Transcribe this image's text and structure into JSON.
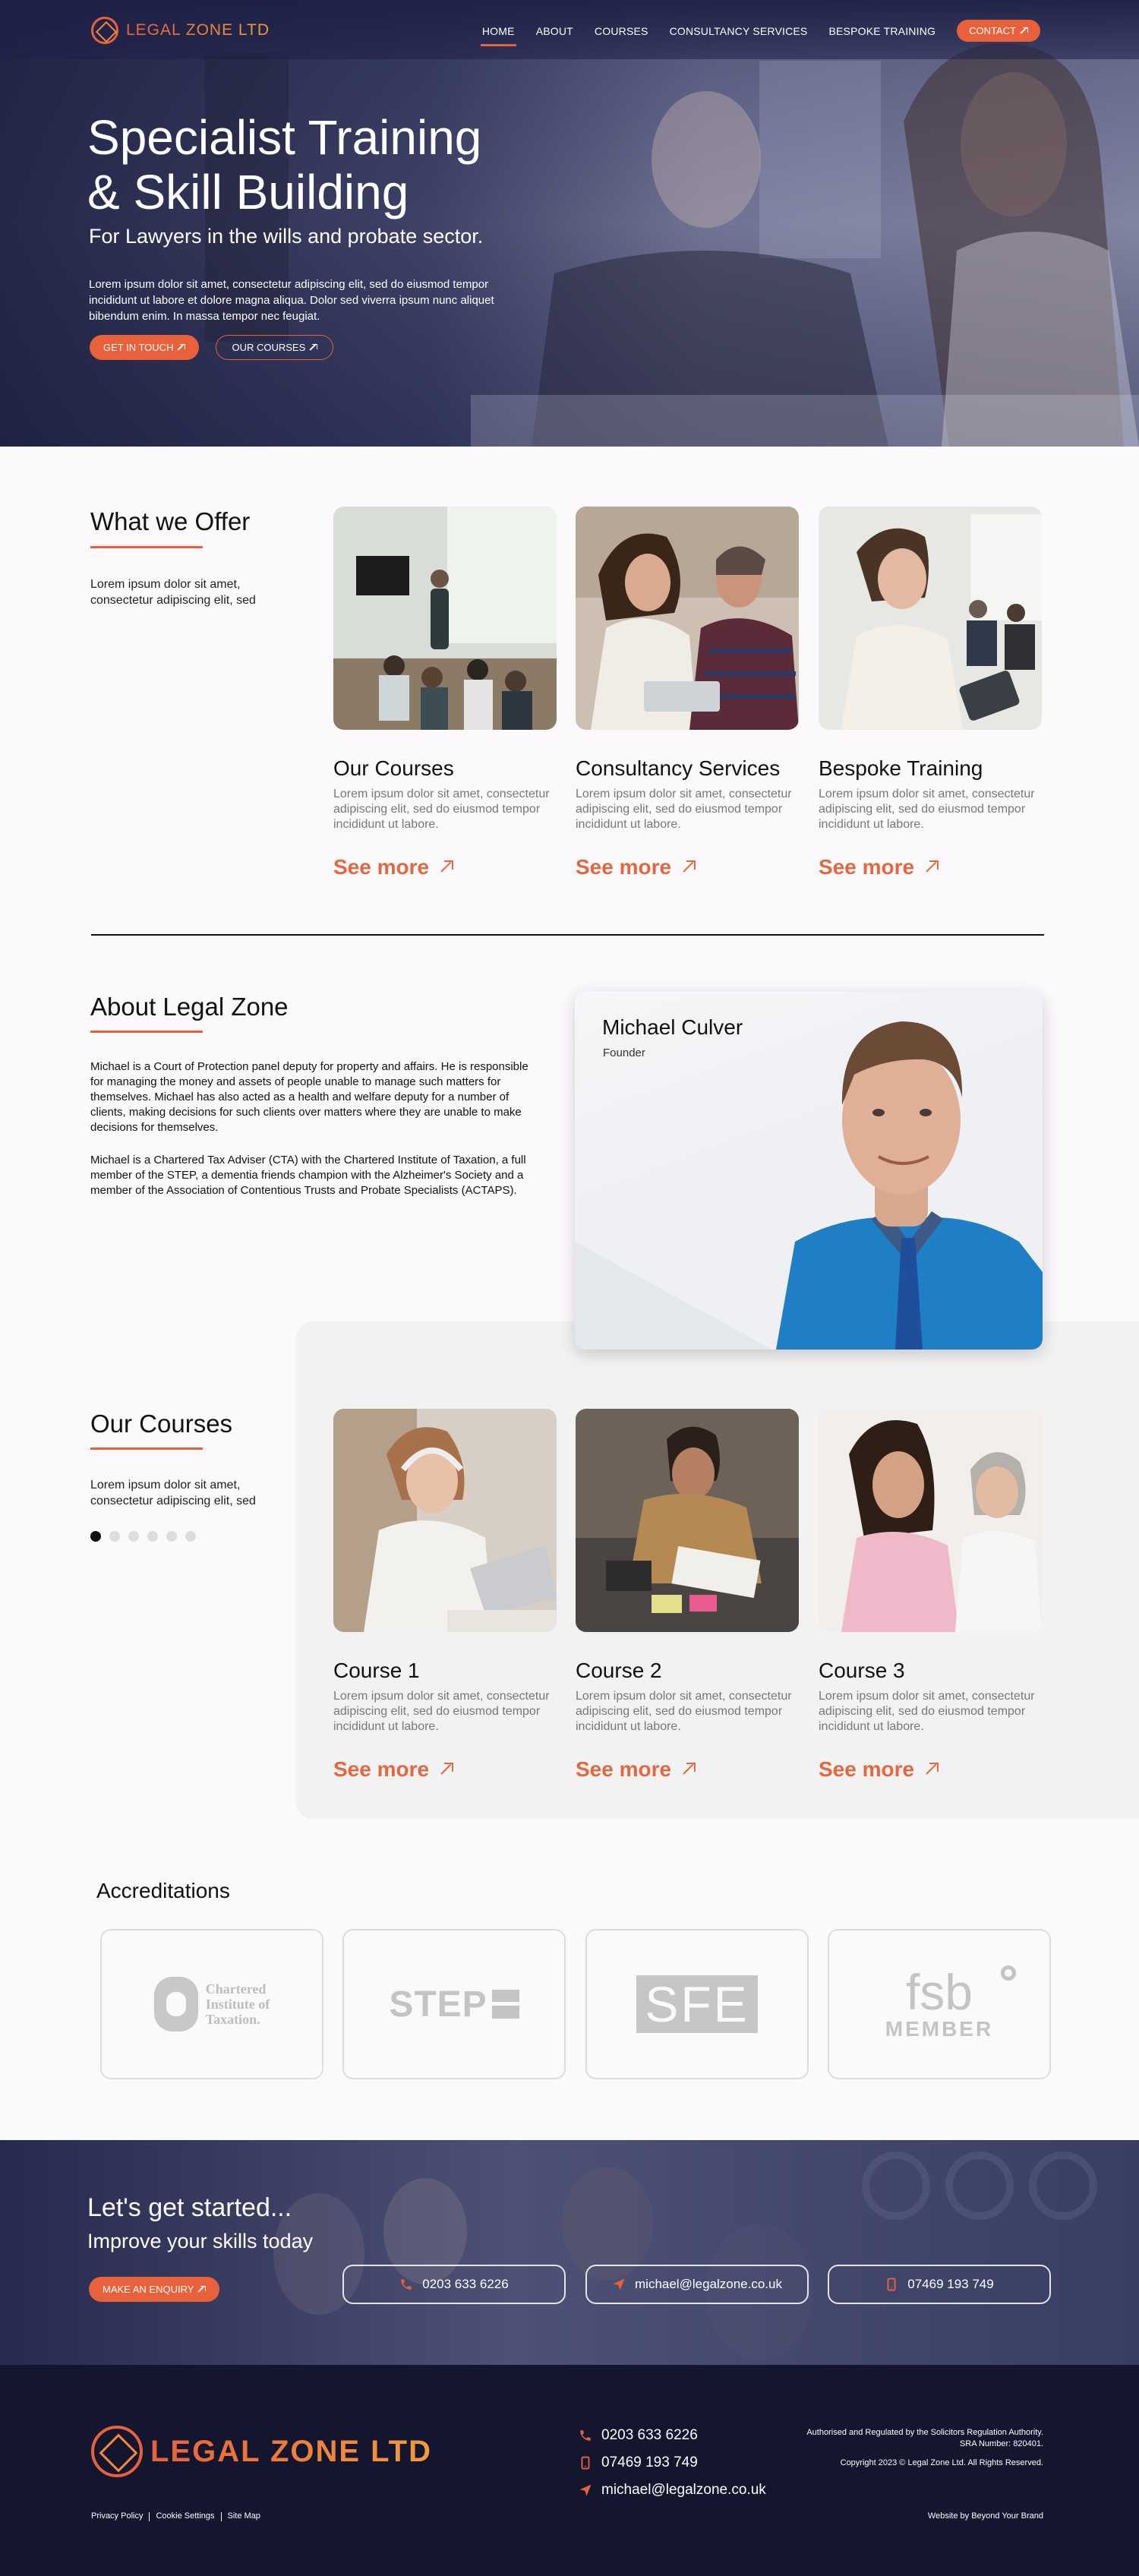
{
  "nav": {
    "logo_text": "LEGAL ZONE LTD",
    "links": [
      {
        "label": "HOME",
        "active": true
      },
      {
        "label": "ABOUT"
      },
      {
        "label": "COURSES"
      },
      {
        "label": "CONSULTANCY SERVICES"
      },
      {
        "label": "BESPOKE TRAINING"
      }
    ],
    "contact_label": "CONTACT"
  },
  "hero": {
    "title_line1": "Specialist Training",
    "title_line2": "& Skill Building",
    "subtitle": "For Lawyers in the wills and probate sector.",
    "description": "Lorem ipsum dolor sit amet, consectetur adipiscing elit, sed do eiusmod tempor incididunt ut labore et dolore magna aliqua. Dolor sed viverra ipsum nunc aliquet bibendum enim. In massa tempor nec feugiat.",
    "primary_button": "GET IN TOUCH",
    "secondary_button": "OUR COURSES"
  },
  "offer": {
    "title": "What we Offer",
    "lead": "Lorem ipsum dolor sit amet, consectetur adipiscing elit, sed",
    "cards": [
      {
        "title": "Our Courses",
        "text": "Lorem ipsum dolor sit amet, consectetur adipiscing elit, sed do eiusmod tempor incididunt ut labore.",
        "link": "See more"
      },
      {
        "title": "Consultancy Services",
        "text": "Lorem ipsum dolor sit amet, consectetur adipiscing elit, sed do eiusmod tempor incididunt ut labore.",
        "link": "See more"
      },
      {
        "title": "Bespoke Training",
        "text": "Lorem ipsum dolor sit amet, consectetur adipiscing elit, sed do eiusmod tempor incididunt ut labore.",
        "link": "See more"
      }
    ]
  },
  "about": {
    "title": "About Legal Zone",
    "paragraph1": "Michael is a Court of Protection panel deputy for property and affairs. He is responsible for managing the money and assets of people unable to manage such matters for themselves. Michael has also acted as a health and welfare deputy for a number of  clients, making decisions for such clients over matters where they are unable to make decisions for themselves.",
    "paragraph2": "Michael is a Chartered Tax Adviser (CTA) with the Chartered Institute of Taxation, a full member of the STEP, a dementia friends champion with the Alzheimer's Society and a member of the Association of Contentious Trusts and Probate Specialists (ACTAPS).",
    "profile_name": "Michael Culver",
    "profile_role": "Founder"
  },
  "courses": {
    "title": "Our Courses",
    "lead": "Lorem ipsum dolor sit amet, consectetur adipiscing elit, sed",
    "active_slide": 1,
    "slide_count": 6,
    "cards": [
      {
        "title": "Course 1",
        "text": "Lorem ipsum dolor sit amet, consectetur adipiscing elit, sed do eiusmod tempor incididunt ut labore.",
        "link": "See more"
      },
      {
        "title": "Course 2",
        "text": "Lorem ipsum dolor sit amet, consectetur adipiscing elit, sed do eiusmod tempor incididunt ut labore.",
        "link": "See more"
      },
      {
        "title": "Course 3",
        "text": "Lorem ipsum dolor sit amet, consectetur adipiscing elit, sed do eiusmod tempor incididunt ut labore.",
        "link": "See more"
      }
    ]
  },
  "accreditations": {
    "title": "Accreditations",
    "logos": [
      {
        "line1": "Chartered",
        "line2": "Institute of",
        "line3": "Taxation."
      },
      {
        "text": "STEP"
      },
      {
        "text": "SFE"
      },
      {
        "text": "fsb",
        "sub": "MEMBER"
      }
    ]
  },
  "cta": {
    "title": "Let's get started...",
    "subtitle": "Improve your skills today",
    "button": "MAKE AN ENQUIRY",
    "phone": "0203 633 6226",
    "email": "michael@legalzone.co.uk",
    "mobile": "07469 193 749"
  },
  "footer": {
    "logo_text": "LEGAL ZONE LTD",
    "phone": "0203 633 6226",
    "mobile": "07469 193 749",
    "email": "michael@legalzone.co.uk",
    "legal_line1": "Authorised and Regulated by the Solicitors Regulation Authority.",
    "legal_line2": "SRA Number: 820401.",
    "copyright": "Copyright 2023 © Legal Zone Ltd. All Rights Reserved.",
    "links": [
      "Privacy Policy",
      "Cookie Settings",
      "Site Map"
    ],
    "credit": "Website by Beyond Your Brand"
  },
  "colors": {
    "accent": "#e8613b",
    "navy": "#14162f",
    "page_bg": "#fcf9fd"
  }
}
